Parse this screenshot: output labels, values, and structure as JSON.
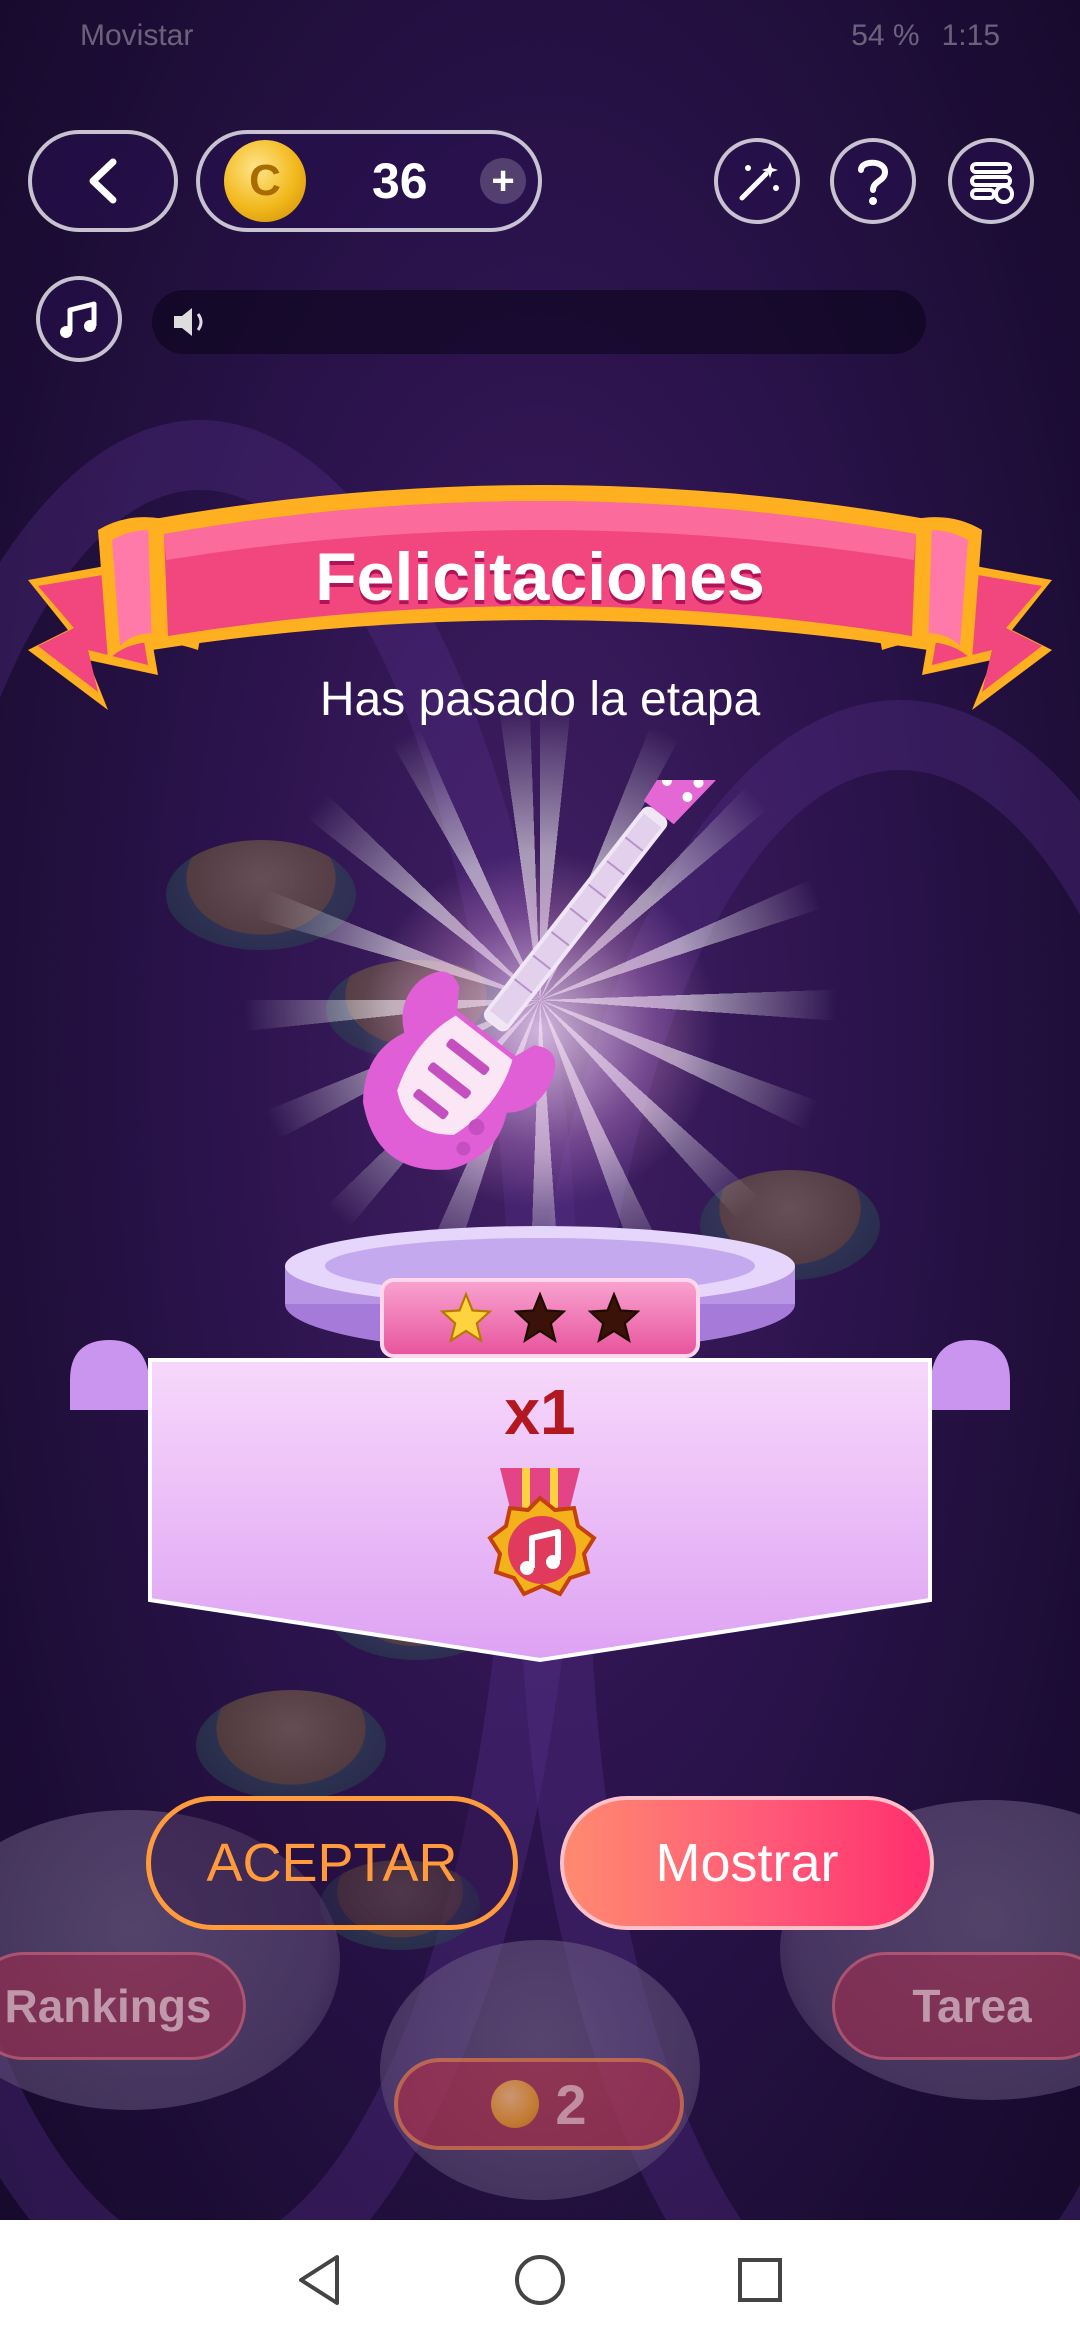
{
  "status_bar": {
    "carrier": "Movistar",
    "battery": "54 %",
    "time": "1:15"
  },
  "hud": {
    "coins": "36",
    "coin_plus": "+",
    "icons": [
      "back-icon",
      "coin-icon",
      "magic-wand-icon",
      "help-icon",
      "menu-icon",
      "music-note-icon",
      "speaker-icon"
    ]
  },
  "dialog": {
    "title": "Felicitaciones",
    "subtitle": "Has pasado la etapa",
    "stars_earned": 1,
    "stars_total": 3,
    "reward_multiplier": "x1",
    "reward_icon": "music-medal-icon",
    "accept_label": "ACEPTAR",
    "show_label": "Mostrar"
  },
  "background_hud": {
    "rankings_label": "Rankings",
    "task_label": "Tarea",
    "play_cost": "2"
  },
  "colors": {
    "ribbon_pink": "#f2467f",
    "ribbon_gold": "#ffb020",
    "accept_orange": "#ff9a3d",
    "show_gradient_start": "#ff8a70",
    "show_gradient_end": "#ff2f6e",
    "multiplier_red": "#b3171f",
    "star_gold": "#ffd23f",
    "star_empty": "#3a1208"
  },
  "nav": {
    "icons": [
      "back-triangle-icon",
      "home-circle-icon",
      "recents-square-icon"
    ]
  }
}
